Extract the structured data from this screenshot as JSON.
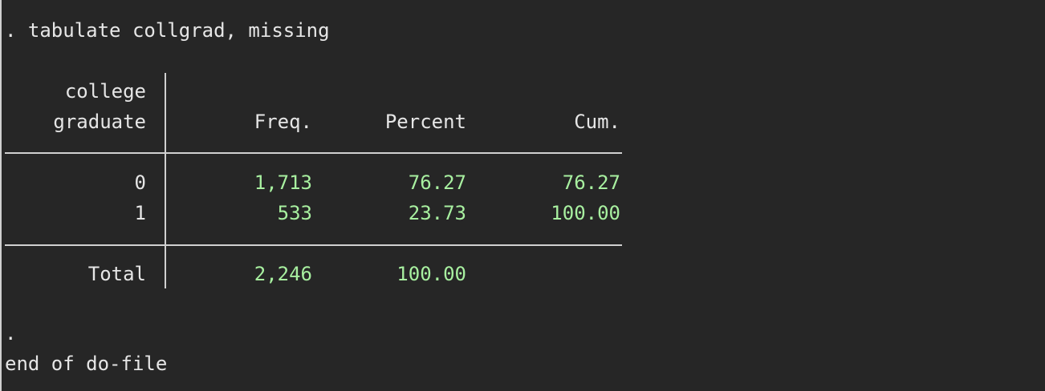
{
  "console": {
    "command": ". tabulate collgrad, missing",
    "prompt_dot": ".",
    "end_message": "end of do-file"
  },
  "table": {
    "var_label_line1": "college",
    "var_label_line2": "graduate",
    "headers": {
      "freq": "Freq.",
      "percent": "Percent",
      "cum": "Cum."
    },
    "rows": [
      {
        "label": "0",
        "freq": "1,713",
        "percent": "76.27",
        "cum": "76.27"
      },
      {
        "label": "1",
        "freq": "533",
        "percent": "23.73",
        "cum": "100.00"
      }
    ],
    "total": {
      "label": "Total",
      "freq": "2,246",
      "percent": "100.00"
    }
  },
  "colors": {
    "background": "#262626",
    "text": "#e6e6e6",
    "result_value": "#a8f0a0",
    "rule": "#d0d0d0"
  }
}
